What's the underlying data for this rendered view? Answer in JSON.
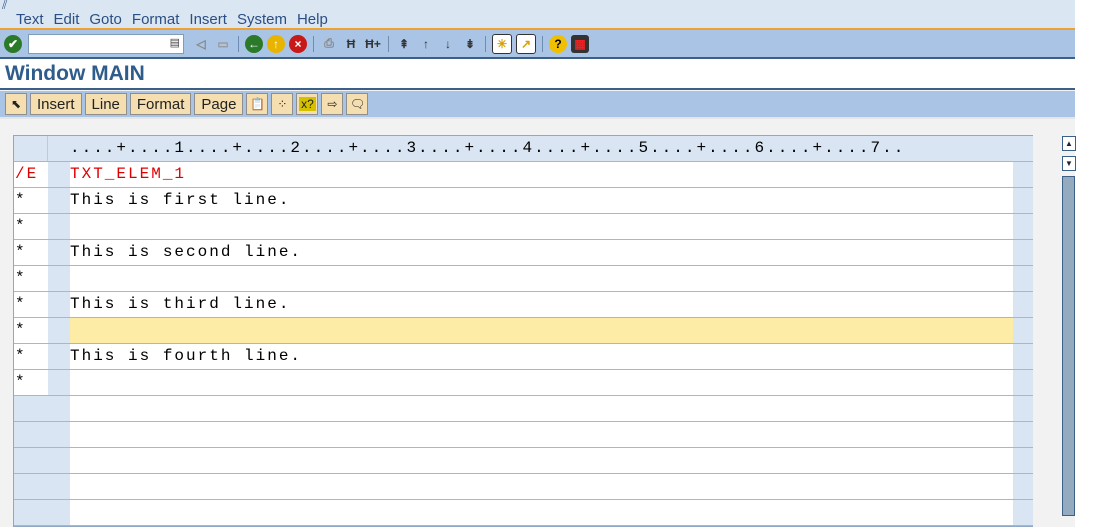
{
  "menu": {
    "items": [
      "Text",
      "Edit",
      "Goto",
      "Format",
      "Insert",
      "System",
      "Help"
    ]
  },
  "toolbar": {
    "command_value": "",
    "command_placeholder": ""
  },
  "title": "Window MAIN",
  "app_toolbar": {
    "buttons": [
      "Insert",
      "Line",
      "Format",
      "Page"
    ]
  },
  "editor": {
    "ruler": "....+....1....+....2....+....3....+....4....+....5....+....6....+....7..",
    "lines": [
      {
        "marker": "/E",
        "text": "TXT_ELEM_1",
        "red": true
      },
      {
        "marker": "*",
        "text": "This is first line."
      },
      {
        "marker": "*",
        "text": ""
      },
      {
        "marker": "*",
        "text": "This is second line."
      },
      {
        "marker": "*",
        "text": ""
      },
      {
        "marker": "*",
        "text": "This is third line."
      },
      {
        "marker": "*",
        "text": "",
        "highlight": true
      },
      {
        "marker": "*",
        "text": "This is fourth line."
      },
      {
        "marker": "*",
        "text": ""
      }
    ],
    "empty_rows": 5
  }
}
